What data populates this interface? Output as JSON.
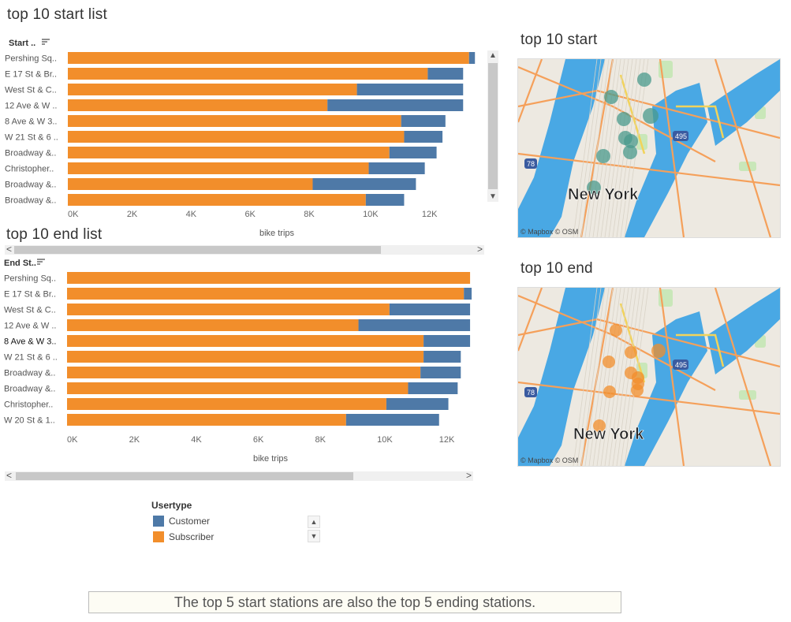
{
  "colors": {
    "customer": "#4e79a7",
    "subscriber": "#f28e2b",
    "start_dot": "#4a9a8c",
    "end_dot": "#f28e2b"
  },
  "titles": {
    "start_list": "top 10 start list",
    "end_list": "top 10 end list",
    "start_map": "top 10 start",
    "end_map": "top 10 end"
  },
  "maps": {
    "city_label": "New York",
    "attribution": "© Mapbox © OSM",
    "highway_label": "495",
    "highway_label2": "78"
  },
  "legend": {
    "title": "Usertype",
    "items": [
      {
        "label": "Customer",
        "color": "#4e79a7"
      },
      {
        "label": "Subscriber",
        "color": "#f28e2b"
      }
    ]
  },
  "note": "The top 5 start stations are also the top 5 ending stations.",
  "chart_data": [
    {
      "type": "bar",
      "header": "Start ..",
      "xlabel": "bike trips",
      "xticks": [
        "0K",
        "2K",
        "4K",
        "6K",
        "8K",
        "10K",
        "12K"
      ],
      "xlim": [
        0,
        13500
      ],
      "categories": [
        "Pershing Sq..",
        "E 17 St & Br..",
        "West St & C..",
        "12 Ave & W ..",
        "8 Ave & W 3..",
        "W 21 St & 6 ..",
        "Broadway &..",
        "Christopher..",
        "Broadway &..",
        "Broadway &.."
      ],
      "series": [
        {
          "name": "Subscriber",
          "values": [
            13600,
            12200,
            9800,
            8800,
            11300,
            11400,
            10900,
            10200,
            8300,
            10100
          ]
        },
        {
          "name": "Customer",
          "values": [
            200,
            1200,
            3600,
            4600,
            1500,
            1300,
            1600,
            1900,
            3500,
            1300
          ]
        }
      ]
    },
    {
      "type": "bar",
      "header": "End St..",
      "xlabel": "bike trips",
      "xticks": [
        "0K",
        "2K",
        "4K",
        "6K",
        "8K",
        "10K",
        "12K"
      ],
      "xlim": [
        0,
        13100
      ],
      "categories": [
        "Pershing Sq..",
        "E 17 St & Br..",
        "West St & C..",
        "12 Ave & W ..",
        "8 Ave & W 3..",
        "W 21 St & 6 ..",
        "Broadway &..",
        "Broadway &..",
        "Christopher..",
        "W 20 St & 1.."
      ],
      "series": [
        {
          "name": "Subscriber",
          "values": [
            13000,
            12800,
            10400,
            9400,
            11500,
            11500,
            11400,
            11000,
            10300,
            9000
          ]
        },
        {
          "name": "Customer",
          "values": [
            0,
            250,
            2600,
            3600,
            1500,
            1200,
            1300,
            1600,
            2000,
            3000
          ]
        }
      ]
    }
  ]
}
